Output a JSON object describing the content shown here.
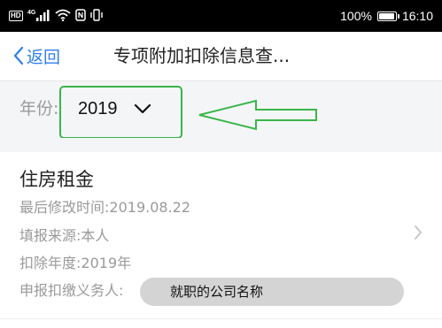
{
  "status_bar": {
    "hd": "HD",
    "network": "4G",
    "battery_percent_text": "100%",
    "battery_level": 1.0,
    "time": "16:10",
    "icons": [
      "hd-icon",
      "signal-icon",
      "wifi-icon",
      "nfc-icon",
      "vibrate-icon",
      "battery-icon"
    ]
  },
  "nav": {
    "back_label": "返回",
    "title": "专项附加扣除信息查..."
  },
  "filter": {
    "year_label": "年份:",
    "year_value": "2019"
  },
  "record": {
    "title": "住房租金",
    "last_modified_label": "最后修改时间:",
    "last_modified_value": "2019.08.22",
    "source_label": "填报来源:",
    "source_value": "本人",
    "deduction_year_label": "扣除年度:",
    "deduction_year_value": "2019年",
    "withholder_label": "申报扣缴义务人:",
    "withholder_value": "就职的公司名称"
  },
  "colors": {
    "accent_blue": "#2f7ef0",
    "annotation_green": "#39b54a",
    "background_gray": "#f4f5f7",
    "muted_text": "#9a9a9a"
  }
}
